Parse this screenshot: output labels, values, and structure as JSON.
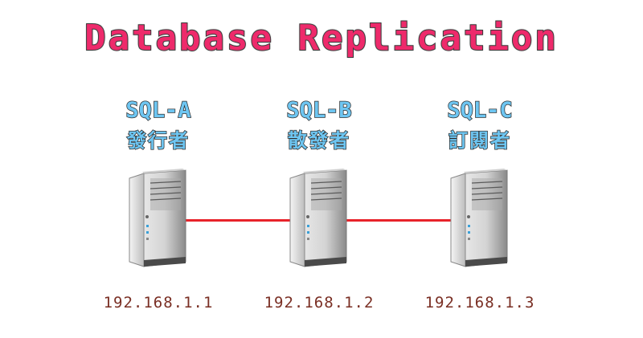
{
  "diagram": {
    "title": "Database Replication",
    "nodes": [
      {
        "name": "SQL-A",
        "role": "發行者",
        "ip": "192.168.1.1"
      },
      {
        "name": "SQL-B",
        "role": "散發者",
        "ip": "192.168.1.2"
      },
      {
        "name": "SQL-C",
        "role": "訂閱者",
        "ip": "192.168.1.3"
      }
    ],
    "links": [
      {
        "from": "SQL-A",
        "to": "SQL-B"
      },
      {
        "from": "SQL-B",
        "to": "SQL-C"
      }
    ],
    "colors": {
      "title": "#ee2a6b",
      "node_label": "#6ec6f2",
      "ip_text": "#7a2f24",
      "link": "#e8222a"
    },
    "icon": "server-tower-icon"
  }
}
